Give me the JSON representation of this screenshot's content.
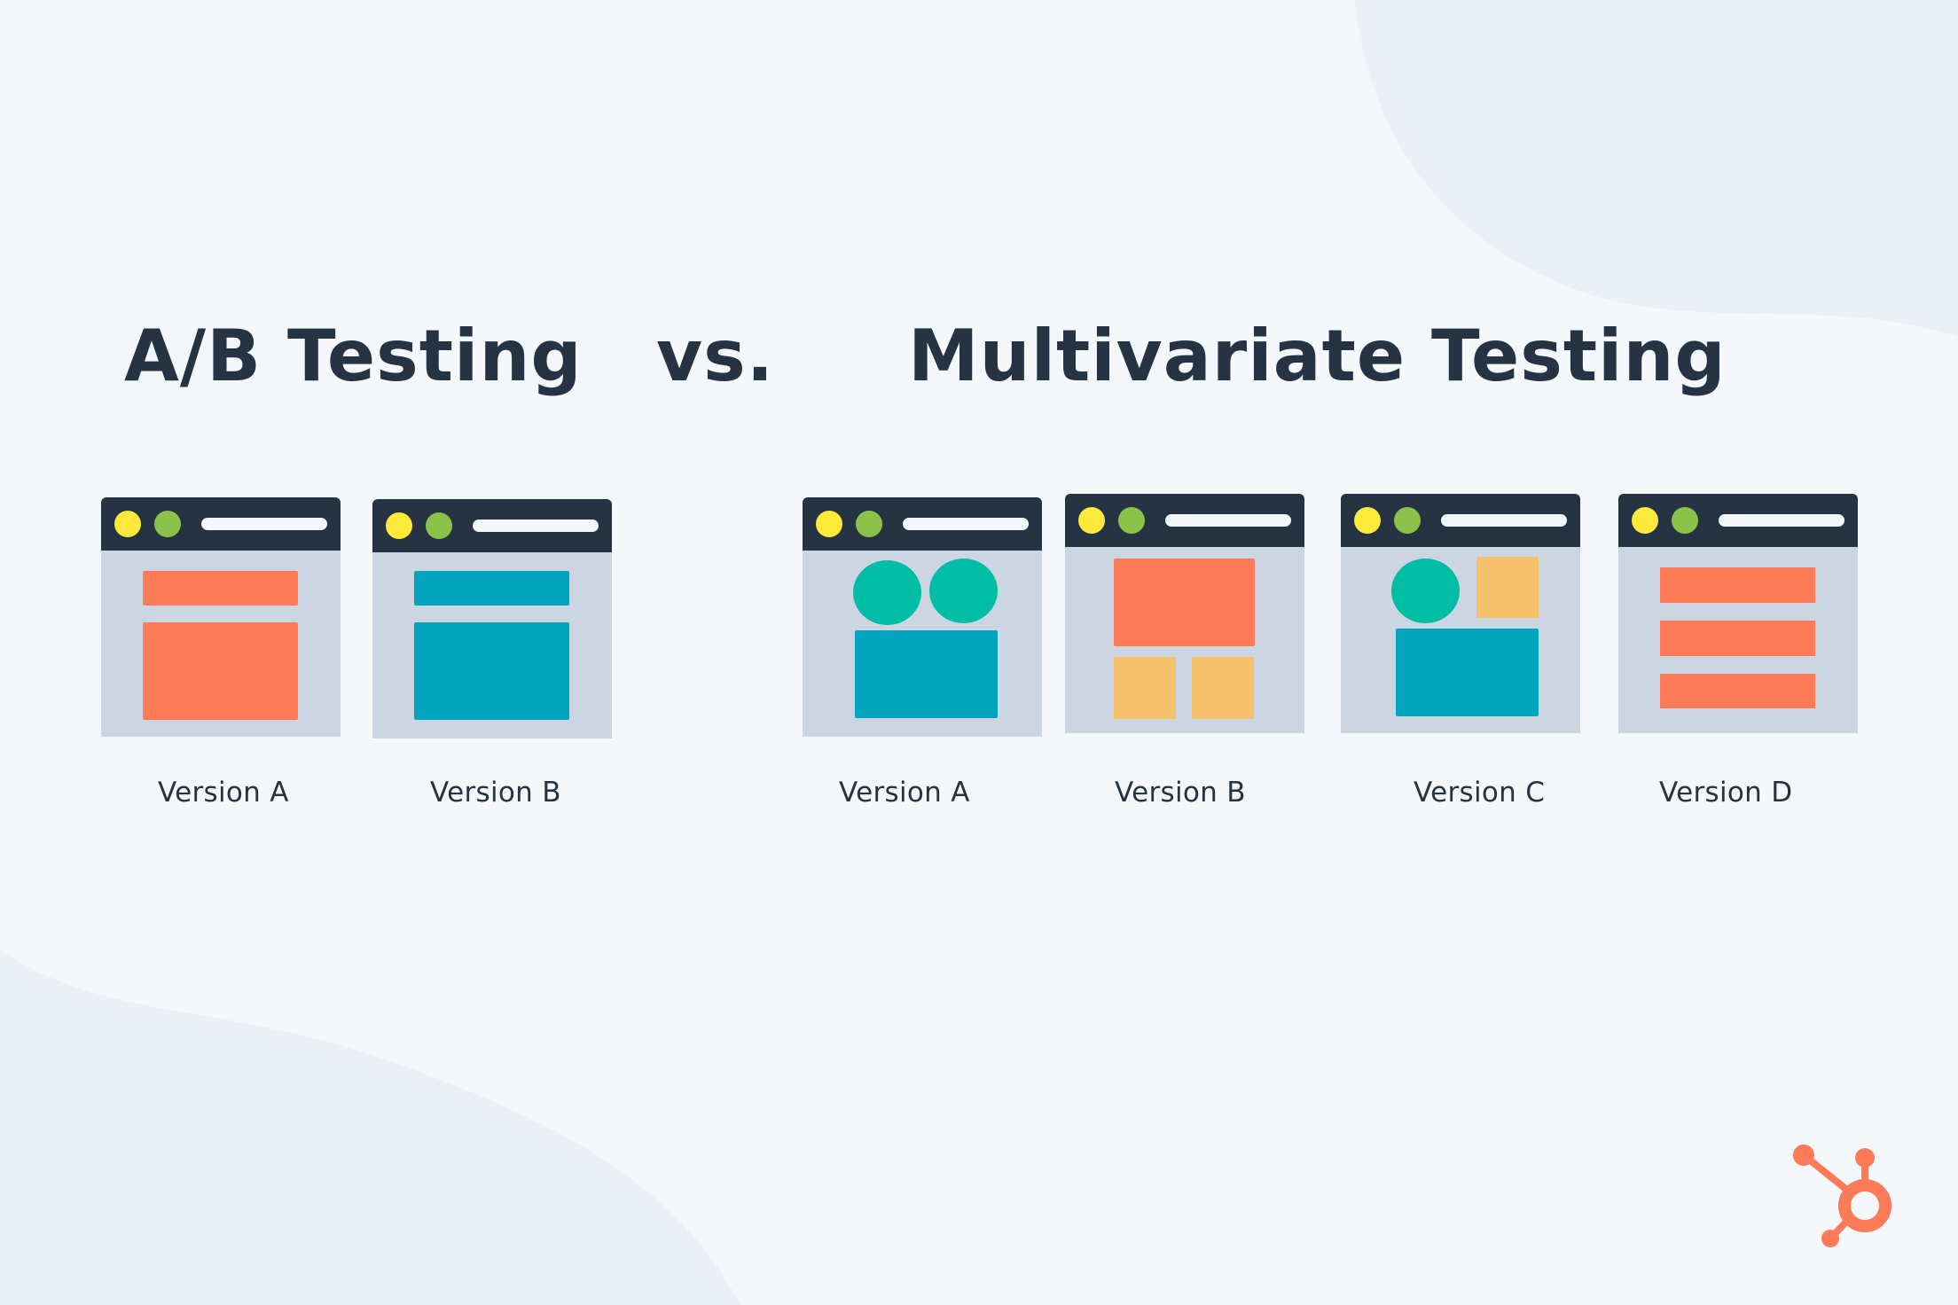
{
  "titles": {
    "ab": "A/B Testing",
    "vs": "vs.",
    "multivariate": "Multivariate Testing"
  },
  "ab_testing": {
    "versions": [
      {
        "label": "Version A",
        "layout": "header-block + content-block",
        "color": "#FF7A59"
      },
      {
        "label": "Version B",
        "layout": "header-block + content-block",
        "color": "#00A4BD"
      }
    ]
  },
  "multivariate_testing": {
    "versions": [
      {
        "label": "Version A",
        "layout": "two circles + content-block"
      },
      {
        "label": "Version B",
        "layout": "hero-block + two squares"
      },
      {
        "label": "Version C",
        "layout": "circle + square + content-block"
      },
      {
        "label": "Version D",
        "layout": "three stacked bars"
      }
    ]
  },
  "colors": {
    "background": "#F4F8FB",
    "blob": "#EAF0F6",
    "text": "#253342",
    "browser_bar": "#253342",
    "browser_body": "#CBD6E2",
    "dot_yellow": "#FFE93A",
    "dot_green": "#8BC34A",
    "orange": "#FF7A59",
    "blue": "#00A4BD",
    "teal": "#00BDA5",
    "gold": "#F5C26B"
  },
  "logo": {
    "icon": "hubspot-sprocket-icon",
    "color": "#FF7A59"
  }
}
